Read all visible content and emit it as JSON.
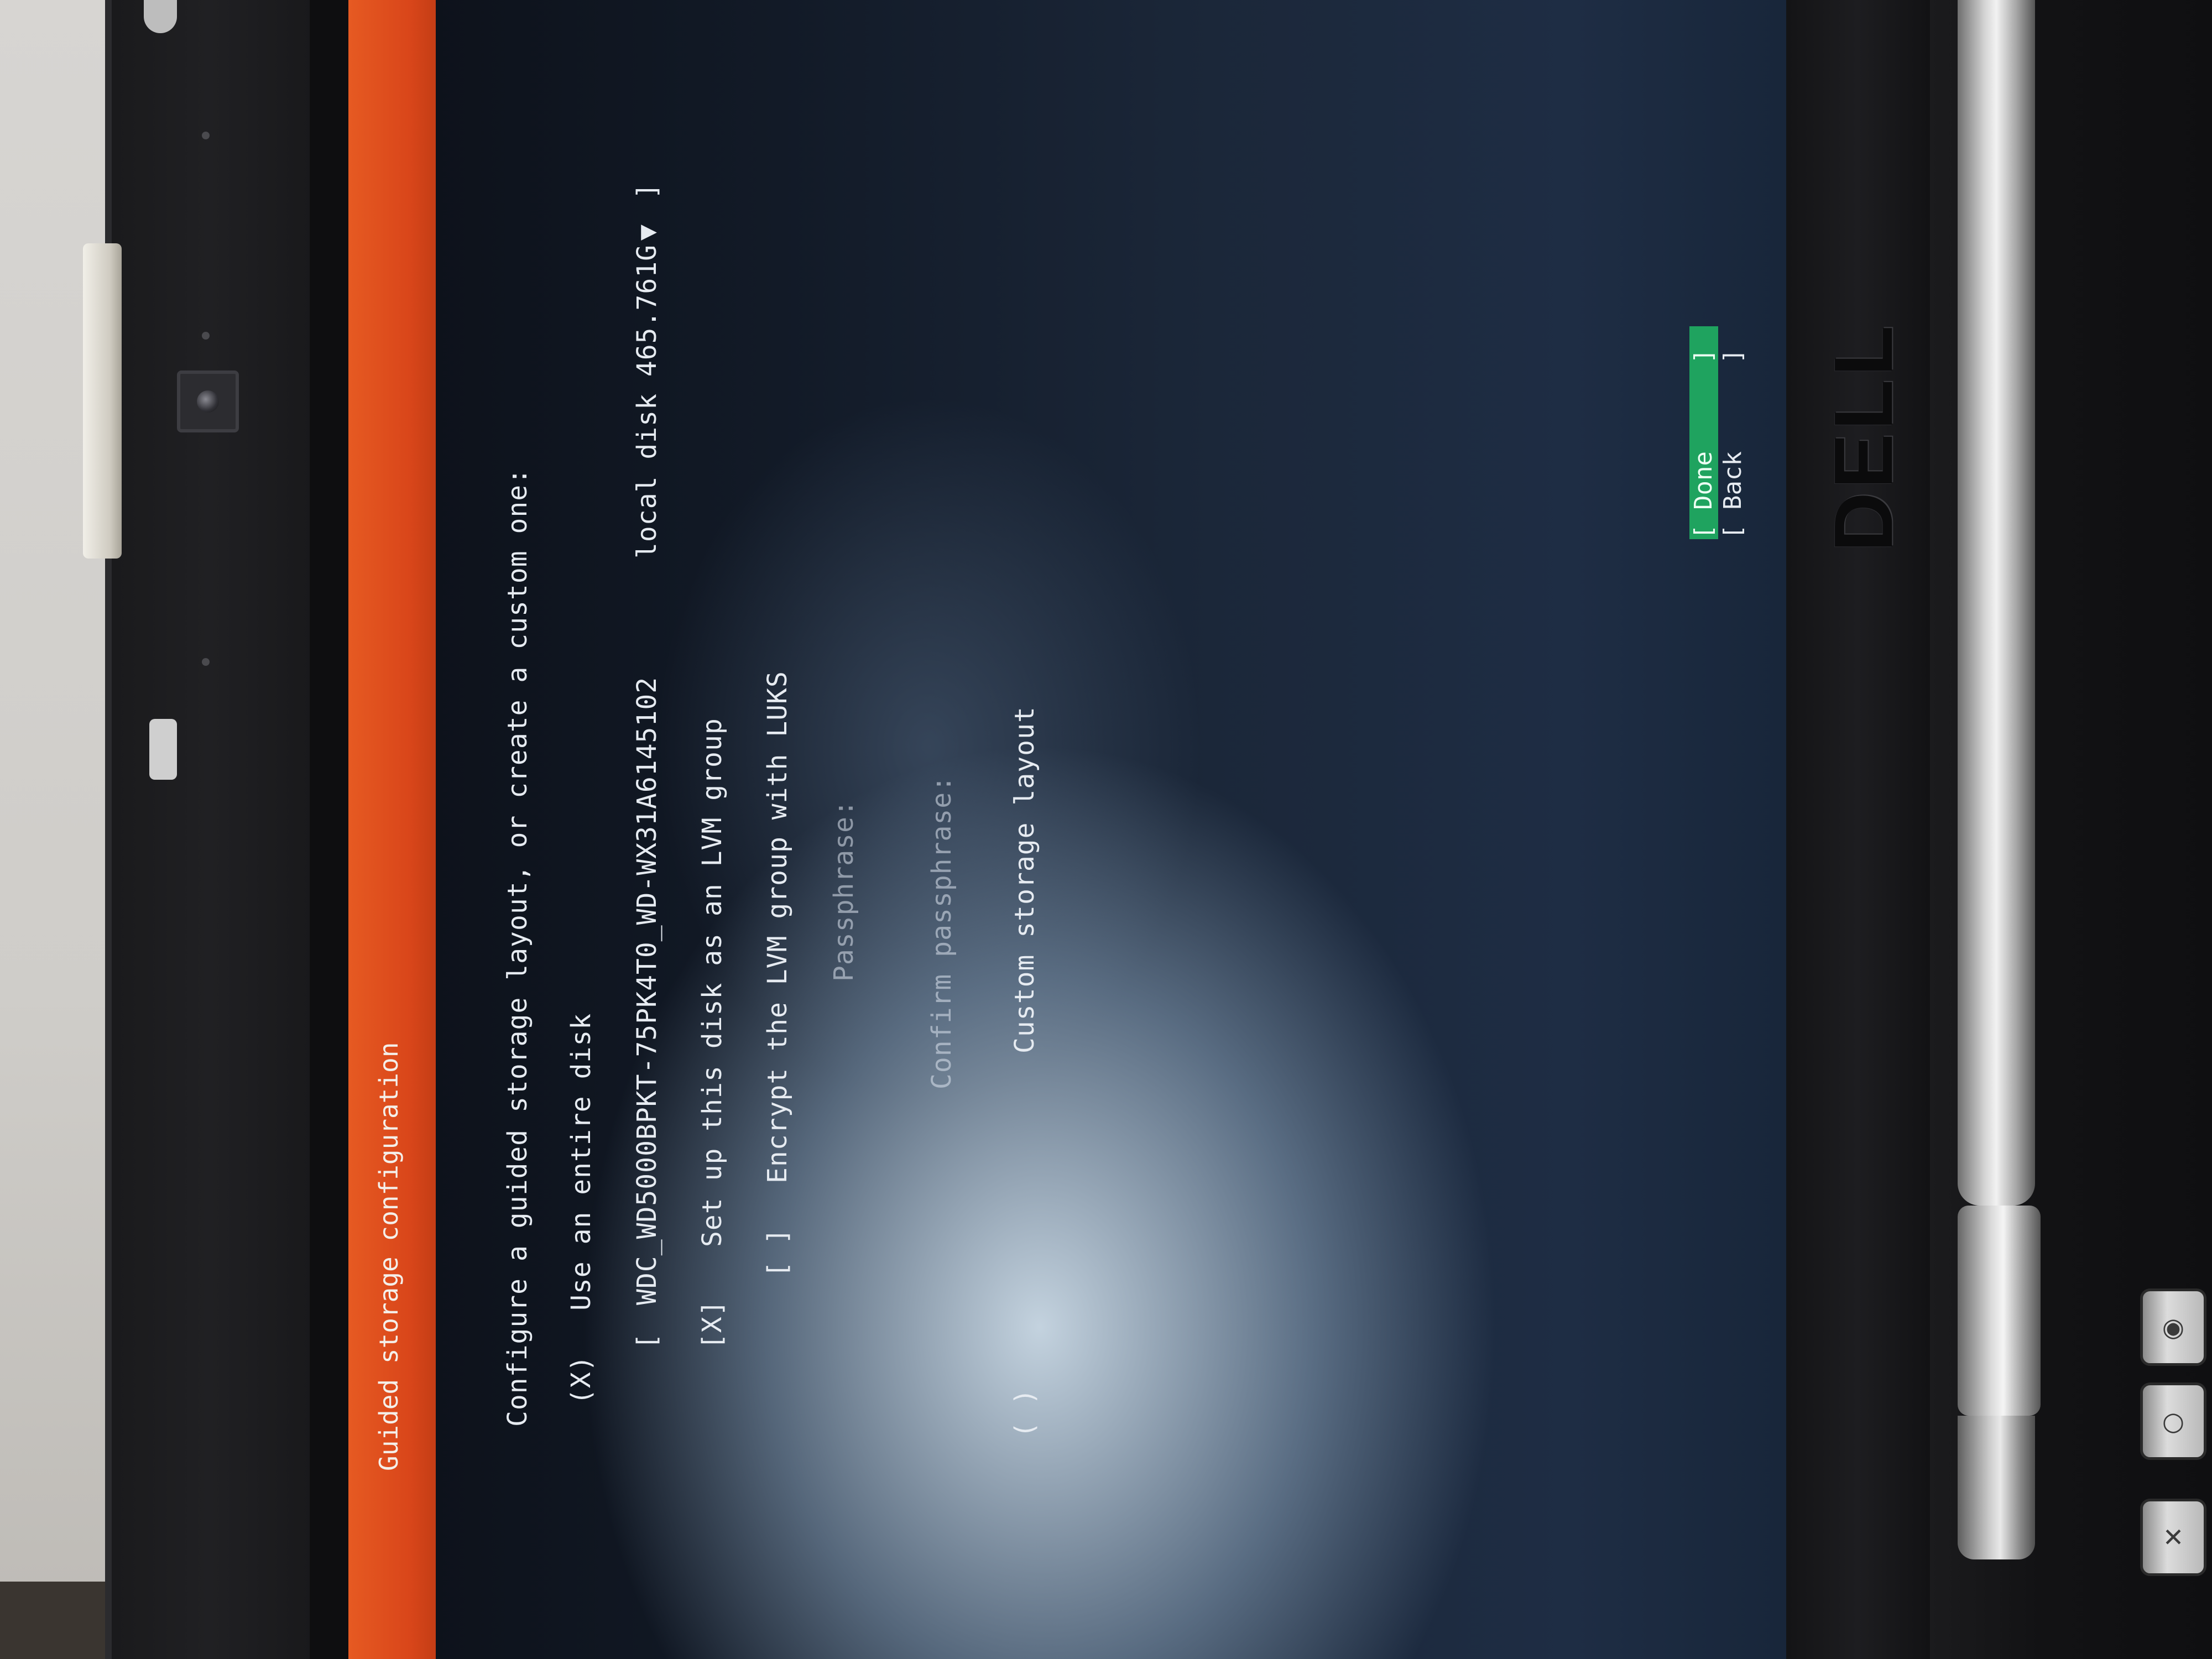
{
  "installer": {
    "title": "Guided storage configuration",
    "intro": "Configure a guided storage layout, or create a custom one:",
    "use_entire_disk": {
      "marker": "(X)",
      "label": "Use an entire disk"
    },
    "disk_select": {
      "left_bracket": "[",
      "disk_name": "WDC_WD5000BPKT-75PK4T0_WD-WX31A6145102",
      "disk_desc": "local disk 465.761G",
      "arrow": "▼",
      "right_bracket": "]"
    },
    "lvm": {
      "marker": "[X]",
      "label": "Set up this disk as an LVM group"
    },
    "encrypt": {
      "marker": "[ ]",
      "label": "Encrypt the LVM group with LUKS"
    },
    "passphrase": {
      "label": "Passphrase:"
    },
    "confirm_passphrase": {
      "label": "Confirm passphrase:"
    },
    "custom_layout": {
      "marker": "( )",
      "label": "Custom storage layout"
    },
    "buttons": {
      "done": "[ Done      ]",
      "back": "[ Back      ]"
    }
  },
  "device": {
    "brand": "DELL"
  },
  "colors": {
    "title_bar": "#e05020",
    "done_highlight": "#1fa35f",
    "text": "#e6ebf1"
  }
}
